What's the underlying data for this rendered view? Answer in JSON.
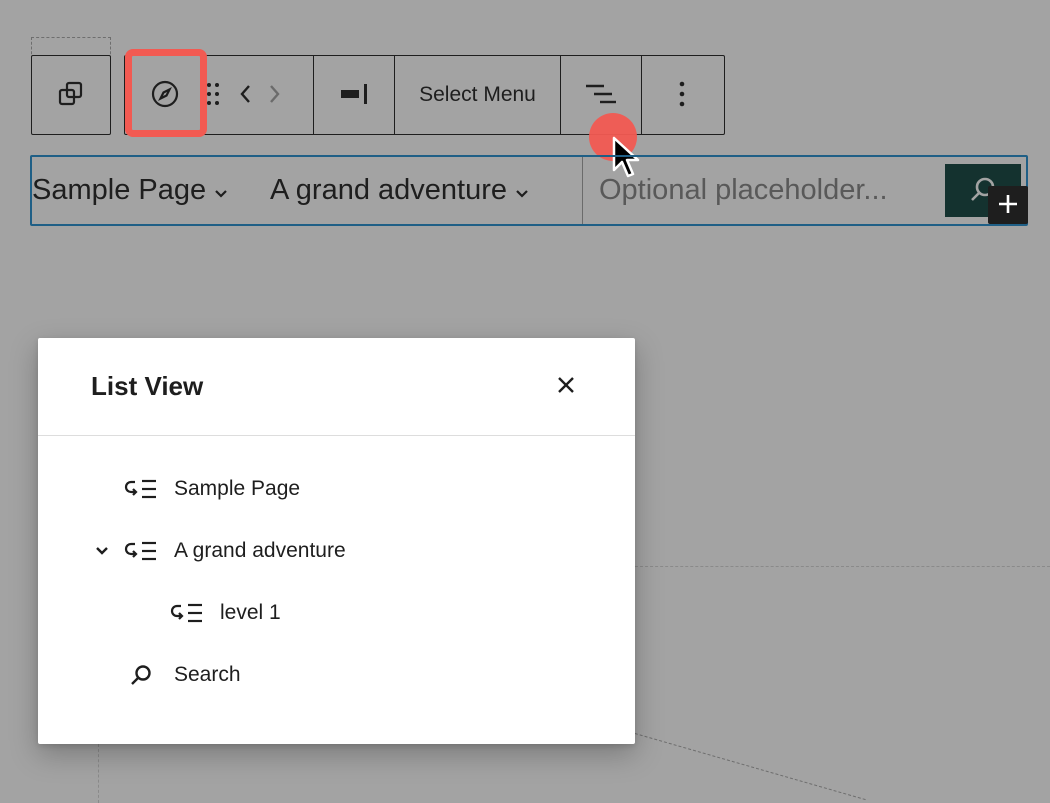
{
  "toolbar": {
    "select_menu_label": "Select Menu"
  },
  "navigation": {
    "items": [
      {
        "label": "Sample Page"
      },
      {
        "label": "A grand adventure"
      }
    ],
    "search_placeholder": "Optional placeholder..."
  },
  "list_view": {
    "title": "List View",
    "items": [
      {
        "label": "Sample Page",
        "icon": "submenu-link-icon"
      },
      {
        "label": "A grand adventure",
        "icon": "submenu-link-icon",
        "expanded": true
      },
      {
        "label": "level 1",
        "icon": "submenu-link-icon"
      },
      {
        "label": "Search",
        "icon": "search-icon"
      }
    ]
  },
  "colors": {
    "highlight": "#f25a52",
    "selection_border": "#1f5f86",
    "search_button": "#14322f",
    "canvas_background": "#a3a3a3"
  }
}
